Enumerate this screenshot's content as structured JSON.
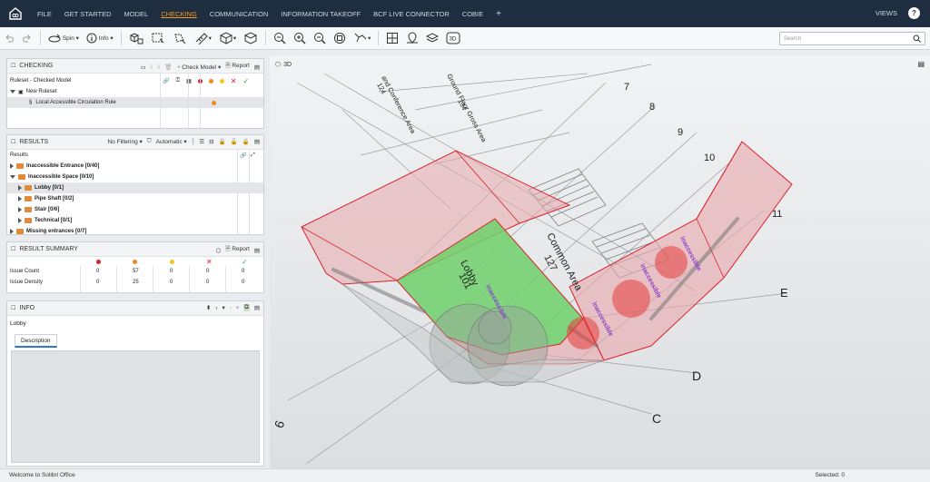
{
  "menu": {
    "items": [
      "FILE",
      "GET STARTED",
      "MODEL",
      "CHECKING",
      "COMMUNICATION",
      "INFORMATION TAKEOFF",
      "BCF LIVE CONNECTOR",
      "COBIE"
    ],
    "active_index": 3,
    "plus": "+",
    "views": "VIEWS",
    "help": "?"
  },
  "toolbar": {
    "spin_label": "Spin",
    "info_label": "Info",
    "threed_label": "3D",
    "search_placeholder": "Search"
  },
  "checking": {
    "title": "CHECKING",
    "check_model_label": "Check Model",
    "report_label": "Report",
    "ruleset_label": "Ruleset - Checked Model",
    "new_ruleset": "New Ruleset",
    "rule": "Local Accessible Circulation Rule",
    "severity_colors": [
      "#d9232a",
      "#ef8a1d",
      "#f5c518",
      "#d9232a",
      "#3aa14a"
    ]
  },
  "results": {
    "title": "RESULTS",
    "filter_label": "No Filtering",
    "mode_label": "Automatic",
    "root_label": "Results",
    "items": [
      {
        "label": "Inaccessible Entrance [0/40]",
        "level": 0,
        "open": false
      },
      {
        "label": "Inaccessible Space [0/10]",
        "level": 0,
        "open": true
      },
      {
        "label": "Lobby [0/1]",
        "level": 1,
        "open": false,
        "selected": true
      },
      {
        "label": "Pipe Shaft [0/2]",
        "level": 1,
        "open": false
      },
      {
        "label": "Stair [0/6]",
        "level": 1,
        "open": false
      },
      {
        "label": "Technical [0/1]",
        "level": 1,
        "open": false
      },
      {
        "label": "Missing entrances [0/7]",
        "level": 0,
        "open": false
      }
    ]
  },
  "summary": {
    "title": "RESULT SUMMARY",
    "report_label": "Report",
    "rows": [
      {
        "label": "Issue Count",
        "values": [
          "0",
          "57",
          "0",
          "0",
          "0"
        ]
      },
      {
        "label": "Issue Density",
        "values": [
          "0",
          "25",
          "0",
          "0",
          "0"
        ]
      }
    ]
  },
  "info": {
    "title": "INFO",
    "selected_name": "Lobby",
    "tab_label": "Description"
  },
  "viewport": {
    "title": "3D",
    "grid_labels": [
      "7",
      "8",
      "9",
      "10",
      "11",
      "E",
      "D",
      "C",
      "6"
    ],
    "room_labels": {
      "lobby": "Lobby",
      "lobby_num": "101",
      "common_area": "Common Area",
      "common_area_num": "127",
      "conference_area": "and Conference Area",
      "conference_num": "124",
      "ground_floor": "Ground Floor Gross Area",
      "ground_floor_num": "134",
      "inaccessible": "inaccessible"
    }
  },
  "status": {
    "left": "Welcome to Solibri Office",
    "right": "Selected: 0"
  }
}
